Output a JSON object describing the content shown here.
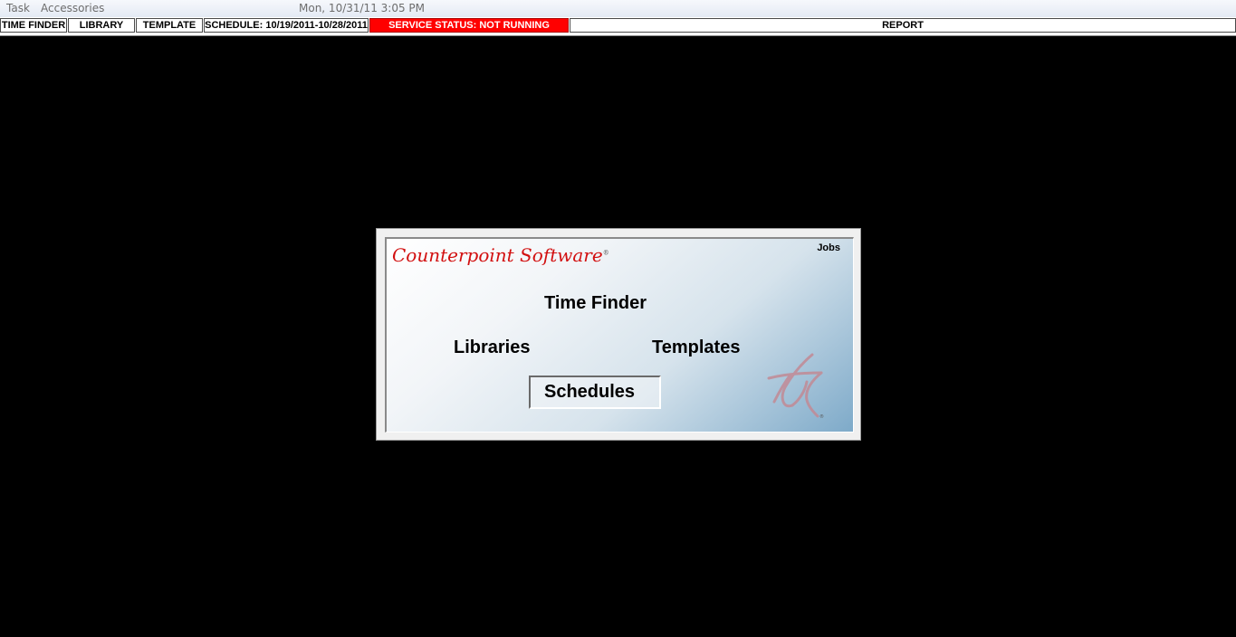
{
  "menubar": {
    "task": "Task",
    "accessories": "Accessories",
    "datetime": "Mon, 10/31/11 3:05 PM"
  },
  "toolbar": {
    "time_finder": "TIME FINDER",
    "library": "LIBRARY",
    "template": "TEMPLATE",
    "schedule": "SCHEDULE: 10/19/2011-10/28/2011",
    "service_status": "SERVICE STATUS: NOT RUNNING",
    "report": "REPORT"
  },
  "dialog": {
    "brand": "Counterpoint Software",
    "brand_mark": "®",
    "jobs": "Jobs",
    "buttons": {
      "time_finder": "Time Finder",
      "libraries": "Libraries",
      "templates": "Templates",
      "schedules": "Schedules"
    },
    "icons": {
      "star": "counterpoint-star-logo-icon"
    }
  },
  "colors": {
    "status_red": "#ff0000",
    "brand_red": "#d21010",
    "background": "#000000"
  }
}
